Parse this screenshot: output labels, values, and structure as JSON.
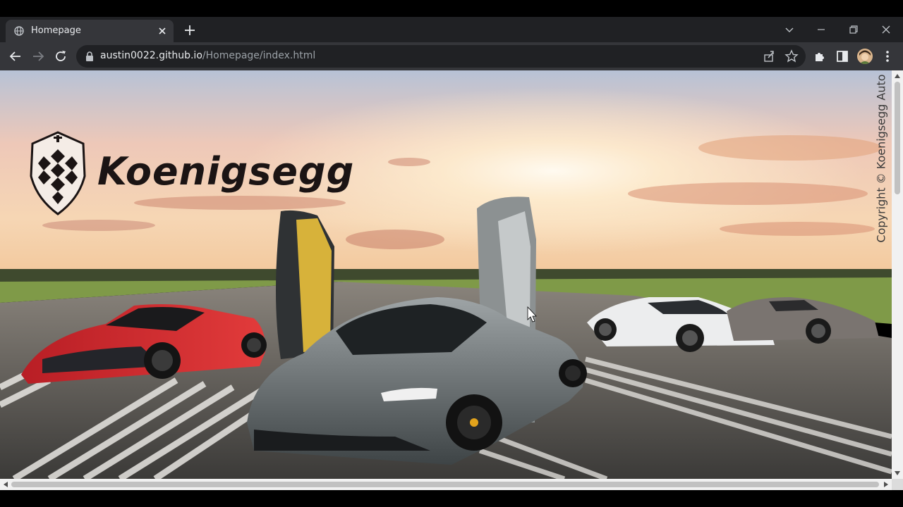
{
  "browser": {
    "tab": {
      "title": "Homepage",
      "favicon": "globe-icon"
    },
    "address_bar": {
      "host": "austin0022.github.io",
      "path": "/Homepage/index.html"
    },
    "icons": {
      "back": "arrow-left-icon",
      "forward": "arrow-right-icon",
      "reload": "reload-icon",
      "share": "share-icon",
      "bookmark": "star-icon",
      "extensions": "puzzle-icon",
      "side_panel": "side-panel-icon",
      "menu": "kebab-menu-icon"
    }
  },
  "page": {
    "brand": "Koenigsegg",
    "copyright": "Copyright © Koenigsegg Auto"
  },
  "colors": {
    "tabstrip": "#202124",
    "toolbar": "#35363a",
    "brand_text": "#1b1414"
  }
}
